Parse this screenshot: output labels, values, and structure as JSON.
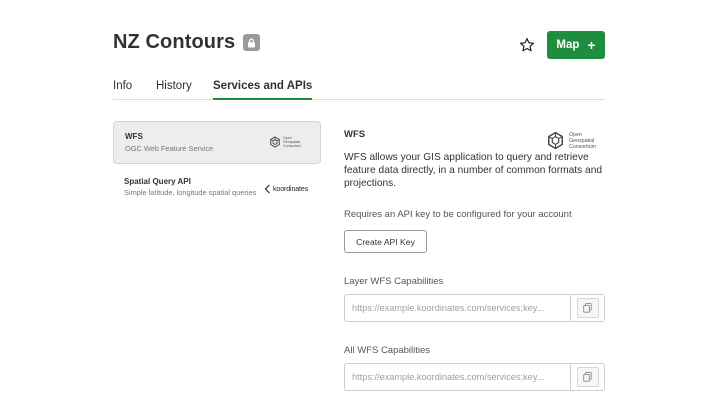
{
  "header": {
    "title": "NZ Contours",
    "map_button_label": "Map",
    "map_button_plus": "+"
  },
  "tabs": [
    {
      "label": "Info",
      "active": false
    },
    {
      "label": "History",
      "active": false
    },
    {
      "label": "Services and APIs",
      "active": true
    }
  ],
  "services": [
    {
      "name": "WFS",
      "description": "OGC Web Feature Service",
      "logo_lines": [
        "Open",
        "Geospatial",
        "Consortium"
      ],
      "selected": true
    },
    {
      "name": "Spatial Query API",
      "description": "Simple latitude, longitude spatial queries",
      "logo_text": "koordinates",
      "selected": false
    }
  ],
  "detail": {
    "title": "WFS",
    "logo_lines": [
      "Open",
      "Geospatial",
      "Consortium"
    ],
    "description": "WFS allows your GIS application to query and retrieve feature data directly, in a number of common formats and projections.",
    "api_key_note": "Requires an API key to be configured for your account",
    "create_key_button": "Create API Key",
    "fields": [
      {
        "label": "Layer WFS Capabilities",
        "placeholder": "https://example.koordinates.com/services;key..."
      },
      {
        "label": "All WFS Capabilities",
        "placeholder": "https://example.koordinates.com/services;key..."
      }
    ]
  },
  "colors": {
    "accent": "#1e8e3e",
    "selected_bg": "#ededed",
    "text": "#323232",
    "muted": "#777777"
  }
}
